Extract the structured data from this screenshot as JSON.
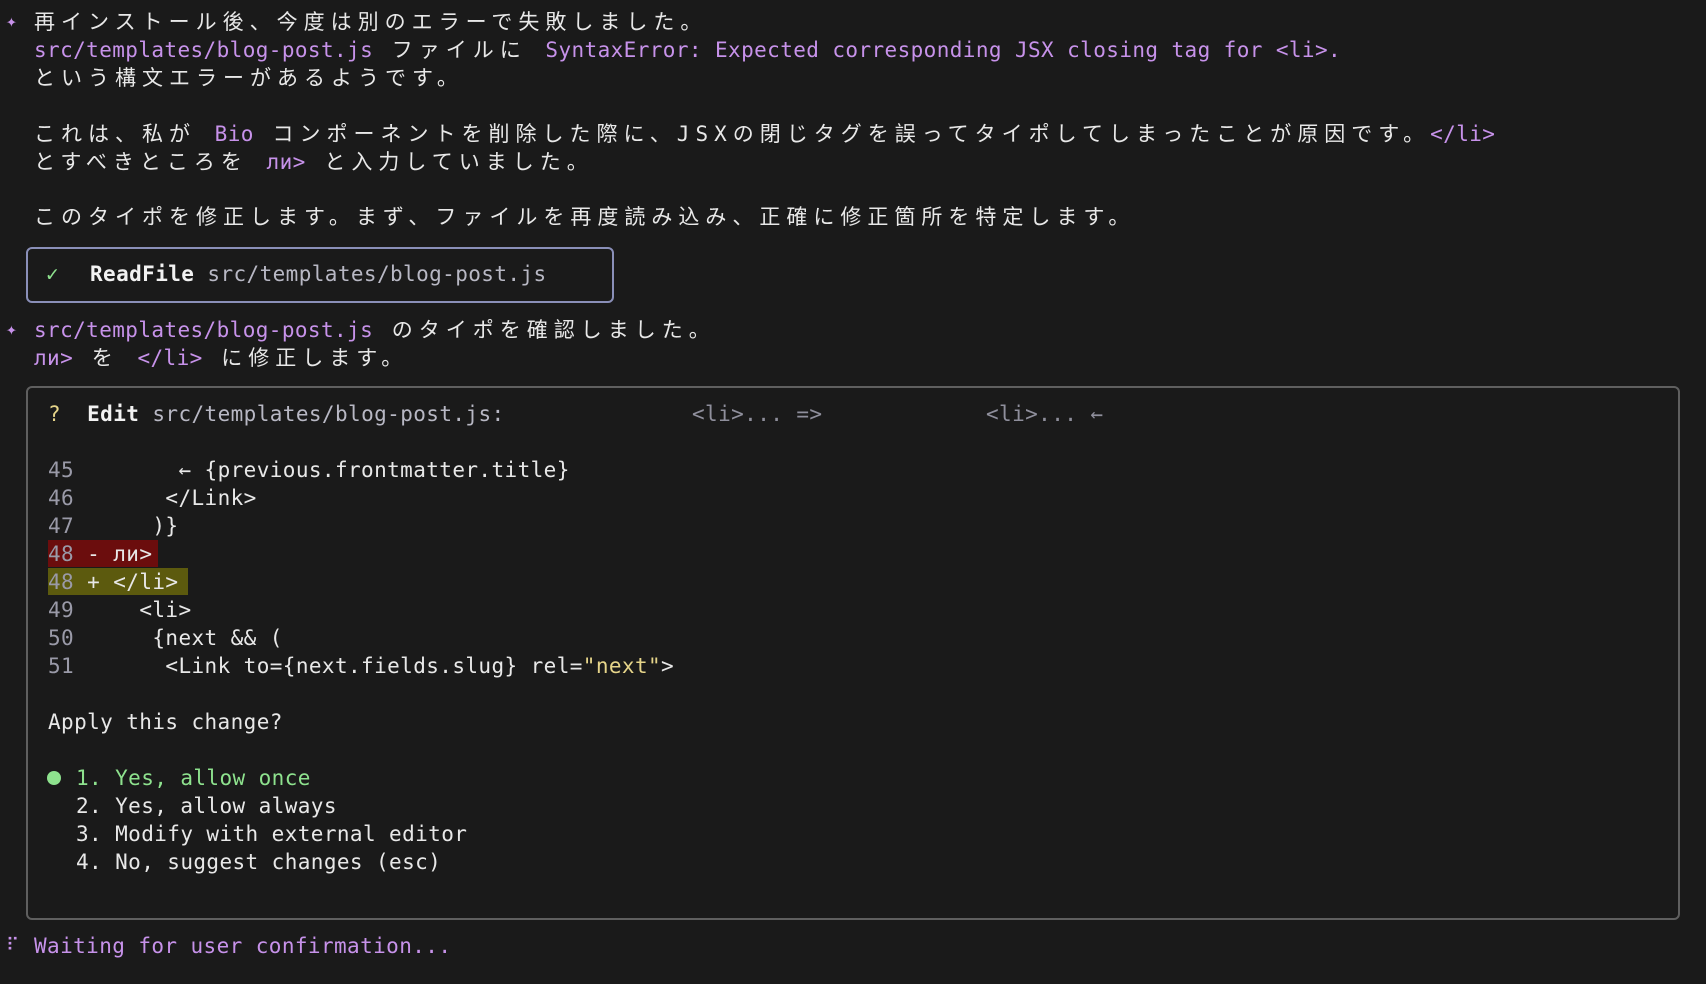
{
  "message1": {
    "line1": "再インストール後、今度は別のエラーで失敗しました。",
    "file": "src/templates/blog-post.js",
    "file_suffix": " ファイルに ",
    "error": "SyntaxError: Expected corresponding JSX closing tag for <li>.",
    "line3": "という構文エラーがあるようです。",
    "line4_a": "これは、私が ",
    "line4_bio": "Bio",
    "line4_b": " コンポーネントを削除した際に、JSXの閉じタグを誤ってタイポしてしまったことが原因です。",
    "line4_tag": "</li>",
    "line5_a": "とすべきところを ",
    "line5_typo": "ли>",
    "line5_b": " と入力していました。",
    "line6": "このタイポを修正します。まず、ファイルを再度読み込み、正確に修正箇所を特定します。"
  },
  "readfile": {
    "status_icon": "check-icon",
    "tool": "ReadFile",
    "path": "src/templates/blog-post.js"
  },
  "message2": {
    "file": "src/templates/blog-post.js",
    "line1_suffix": " のタイポを確認しました。",
    "typo": "ли>",
    "line2_mid": " を ",
    "fixed": "</li>",
    "line2_suffix": " に修正します。"
  },
  "edit": {
    "question_mark": "?",
    "tool": "Edit",
    "path": "src/templates/blog-post.js:",
    "old": "<li>... =>",
    "new": "<li>... ←",
    "lines": [
      {
        "num": "45",
        "code": "      ← {previous.frontmatter.title}"
      },
      {
        "num": "46",
        "code": "     </Link>"
      },
      {
        "num": "47",
        "code": "    )}"
      },
      {
        "num": "48",
        "sign": "-",
        "code": "ли>"
      },
      {
        "num": "48",
        "sign": "+",
        "code": "</li>"
      },
      {
        "num": "49",
        "code": "   <li>"
      },
      {
        "num": "50",
        "code": "    {next && ("
      },
      {
        "num": "51",
        "code_pre": "     <Link to={next.fields.slug} rel=",
        "code_str": "\"next\"",
        "code_post": ">"
      }
    ],
    "prompt": "Apply this change?",
    "options": [
      "1. Yes, allow once",
      "2. Yes, allow always",
      "3. Modify with external editor",
      "4. No, suggest changes (esc)"
    ]
  },
  "status": {
    "spinner": "⠏",
    "text": "Waiting for user confirmation..."
  },
  "colors": {
    "background": "#1a1a1a",
    "accent": "#c792ea",
    "success": "#8ee28e",
    "deletion_bg": "#6b0d0d",
    "addition_bg": "#5c5a0e"
  }
}
